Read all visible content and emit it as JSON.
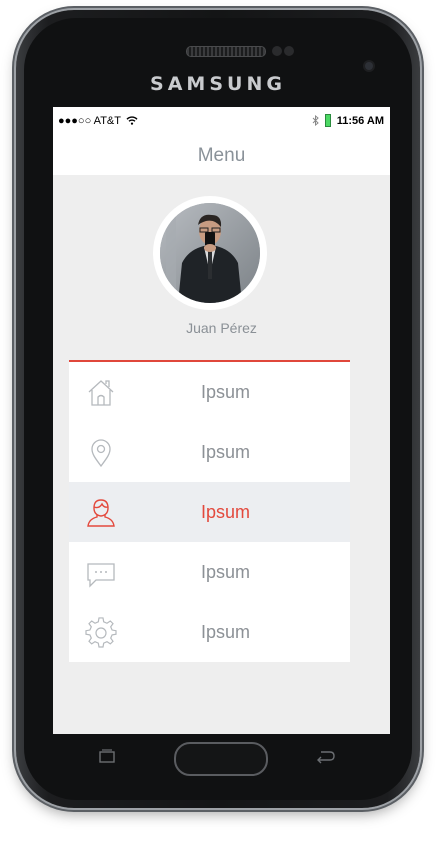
{
  "device": {
    "brand": "SAMSUNG"
  },
  "status_bar": {
    "carrier": "●●●○○ AT&T",
    "time": "11:56 AM"
  },
  "nav": {
    "title": "Menu"
  },
  "profile": {
    "name": "Juan Pérez"
  },
  "colors": {
    "accent": "#e3493d",
    "text_muted": "#8c9196",
    "background": "#eeeeee"
  },
  "menu": {
    "items": [
      {
        "label": "Ipsum",
        "icon": "home-icon",
        "active": false
      },
      {
        "label": "Ipsum",
        "icon": "location-pin-icon",
        "active": false
      },
      {
        "label": "Ipsum",
        "icon": "user-icon",
        "active": true
      },
      {
        "label": "Ipsum",
        "icon": "chat-bubble-icon",
        "active": false
      },
      {
        "label": "Ipsum",
        "icon": "gear-icon",
        "active": false
      }
    ]
  }
}
